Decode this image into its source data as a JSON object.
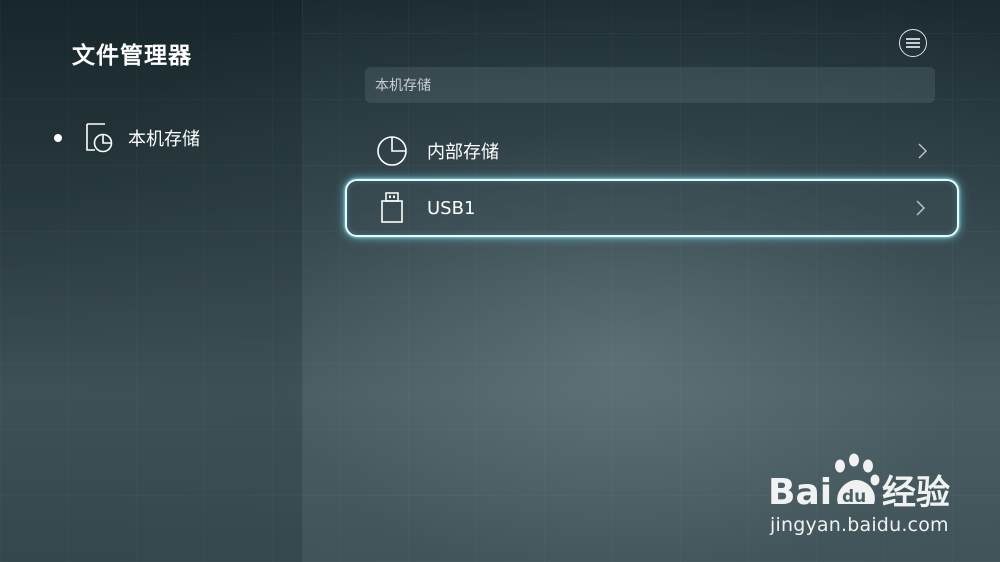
{
  "app": {
    "title": "文件管理器"
  },
  "sidebar": {
    "items": [
      {
        "label": "本机存储",
        "icon": "storage-icon",
        "selected": true
      }
    ]
  },
  "header": {
    "menu_icon": "menu-icon"
  },
  "path_bar": {
    "text": "本机存储"
  },
  "storage_list": [
    {
      "label": "内部存储",
      "icon": "pie-chart-icon",
      "focused": false
    },
    {
      "label": "USB1",
      "icon": "usb-drive-icon",
      "focused": true
    }
  ],
  "watermark": {
    "logo_text": "Bai du 经验",
    "url": "jingyan.baidu.com"
  },
  "colors": {
    "text": "#ffffff",
    "focus_glow": "#7fe6ff",
    "background": "#3a4e53"
  }
}
